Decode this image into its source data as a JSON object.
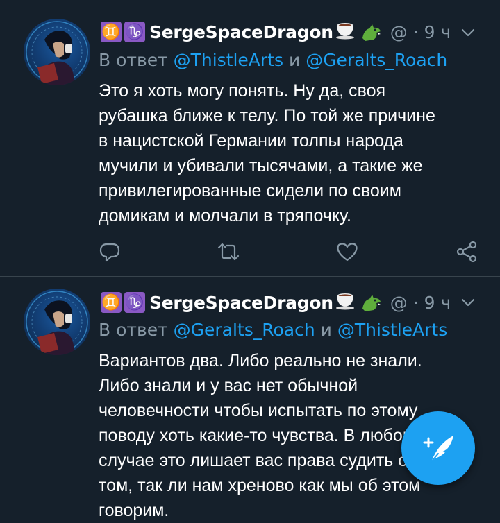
{
  "colors": {
    "background": "#15202b",
    "divider": "#38444d",
    "muted_text": "#8899a6",
    "accent": "#1da1f2",
    "zodiac_badge": "#8a59c4"
  },
  "tweets": [
    {
      "user": {
        "zodiac_1": "♊",
        "zodiac_2": "♑",
        "name": "SergeSpaceDragon",
        "handle": "@",
        "dot": "·",
        "time": "9 ч"
      },
      "reply": {
        "prefix": "В ответ",
        "mention_1": "@ThistleArts",
        "conjunction": "и",
        "mention_2": "@Geralts_Roach"
      },
      "text_lines": [
        "Это я хоть могу понять. Ну да, своя",
        "рубашка ближе к телу. По той же причине",
        "в нацистской Германии толпы народа",
        "мучили и убивали тысячами, а такие же",
        "привилегированные сидели по своим",
        "домикам и молчали в тряпочку."
      ],
      "actions": [
        "reply-icon",
        "retweet-icon",
        "like-icon",
        "share-icon"
      ]
    },
    {
      "user": {
        "zodiac_1": "♊",
        "zodiac_2": "♑",
        "name": "SergeSpaceDragon",
        "handle": "@",
        "dot": "·",
        "time": "9 ч"
      },
      "reply": {
        "prefix": "В ответ",
        "mention_1": "@Geralts_Roach",
        "conjunction": "и",
        "mention_2": "@ThistleArts"
      },
      "text_lines": [
        "Вариантов два. Либо реально не знали.",
        "Либо знали и у вас нет обычной",
        "человечности чтобы испытать по этому",
        "поводу хоть какие-то чувства. В любом",
        "случае это лишает вас права судить о",
        "том, так ли нам хреново как мы об этом",
        "говорим."
      ]
    }
  ],
  "fab": {
    "icon": "compose-tweet-icon"
  }
}
